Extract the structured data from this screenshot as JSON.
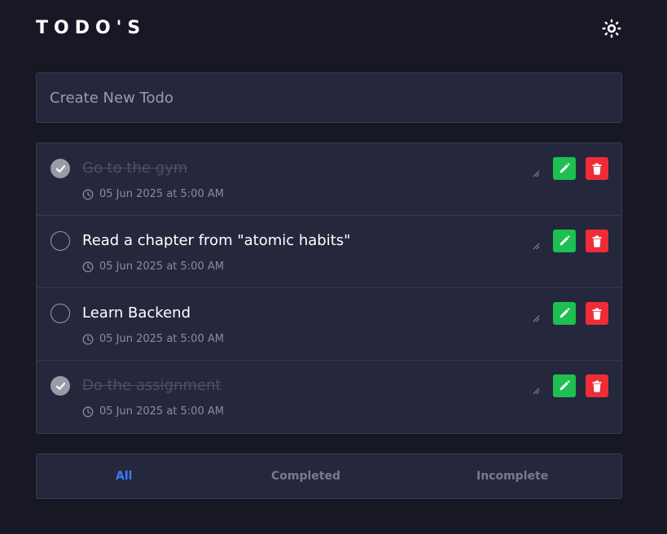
{
  "app": {
    "title": "TODO'S",
    "theme_icon": "sun-icon"
  },
  "new_todo": {
    "placeholder": "Create New Todo",
    "value": ""
  },
  "todos": [
    {
      "text": "Go to the gym",
      "completed": true,
      "time": "05 Jun 2025 at 5:00 AM"
    },
    {
      "text": "Read a chapter from \"atomic habits\"",
      "completed": false,
      "time": "05 Jun 2025 at 5:00 AM"
    },
    {
      "text": "Learn Backend",
      "completed": false,
      "time": "05 Jun 2025 at 5:00 AM"
    },
    {
      "text": "Do the assignment",
      "completed": true,
      "time": "05 Jun 2025 at 5:00 AM"
    }
  ],
  "icons": {
    "edit": "pencil-icon",
    "delete": "trash-icon",
    "time": "clock-icon",
    "check": "check-icon"
  },
  "filters": {
    "all": "All",
    "completed": "Completed",
    "incomplete": "Incomplete",
    "active": "All"
  },
  "colors": {
    "background": "#181824",
    "card": "#25273d",
    "border": "#393a4f",
    "accent": "#3a7bfd",
    "edit": "#1ec052",
    "delete": "#ef2c36",
    "completed_text": "#4e5068"
  }
}
